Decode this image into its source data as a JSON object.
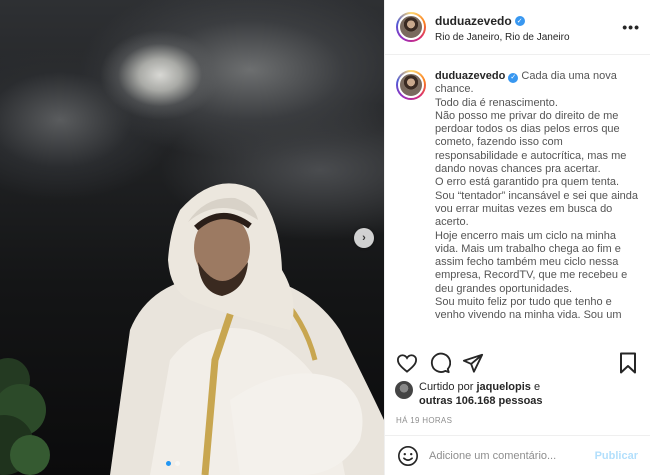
{
  "post": {
    "username": "duduazevedo",
    "location": "Rio de Janeiro, Rio de Janeiro",
    "more_label": "•••",
    "carousel_next": "›",
    "caption_first": "Cada dia uma nova chance.",
    "caption_lines": [
      "Todo dia é renascimento.",
      "Não posso me privar do direito de me perdoar todos os dias pelos erros que cometo, fazendo isso com responsabilidade e autocrítica, mas me dando novas chances pra acertar.",
      "O erro está garantido pra quem tenta.",
      "Sou “tentador” incansável e sei que ainda vou errar muitas vezes em busca do acerto.",
      "Hoje encerro mais um ciclo na minha vida. Mais um trabalho chega ao fim e assim fecho também meu ciclo nessa empresa, RecordTV, que me recebeu e deu grandes oportunidades.",
      "Sou muito feliz por tudo que tenho e venho vivendo na minha vida. Sou um"
    ],
    "liked_prefix": "Curtido por",
    "liked_user": "jaquelopis",
    "liked_middle": "e",
    "liked_others": "outras 106.168 pessoas",
    "time": "HÁ 19 HORAS",
    "comment_placeholder": "Adicione um comentário...",
    "publish_label": "Publicar"
  },
  "icons": {
    "like": "heart-icon",
    "comment": "comment-icon",
    "share": "share-icon",
    "save": "bookmark-icon",
    "emoji": "emoji-icon",
    "verified": "verified-badge-icon"
  },
  "colors": {
    "verified": "#3897f0",
    "publish": "#b2dffc",
    "active_dot": "#2196f3"
  }
}
